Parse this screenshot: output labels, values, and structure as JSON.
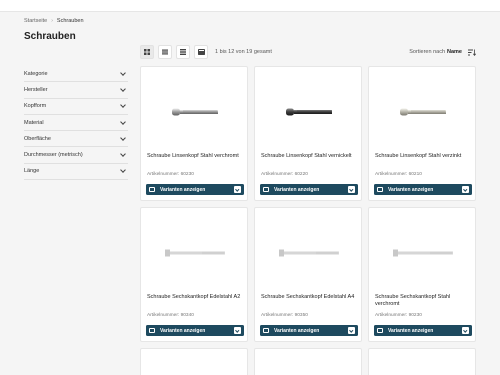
{
  "breadcrumb": {
    "home": "Startseite",
    "current": "Schrauben"
  },
  "page": {
    "title": "Schrauben"
  },
  "filters": [
    {
      "label": "Kategorie"
    },
    {
      "label": "Hersteller"
    },
    {
      "label": "Kopfform"
    },
    {
      "label": "Material"
    },
    {
      "label": "Oberfläche"
    },
    {
      "label": "Durchmesser (metrisch)"
    },
    {
      "label": "Länge"
    }
  ],
  "toolbar": {
    "views": [
      "grid-view-icon",
      "list-view-icon",
      "compact-view-icon",
      "table-view-icon"
    ],
    "active_view": 0,
    "result_count": "1 bis 12 von 19 gesamt",
    "sort_prefix": "Sortieren nach",
    "sort_value": "Name"
  },
  "colors": {
    "accent": "#1e4a5f",
    "background": "#f5f5f5"
  },
  "products": [
    {
      "name": "Schraube Linsenkopf Stahl verchromt",
      "article": "Artikelnummer: 60230",
      "button": "Varianten anzeigen",
      "image": "button-head-screw-chrome"
    },
    {
      "name": "Schraube Linsenkopf Stahl vernickelt",
      "article": "Artikelnummer: 60220",
      "button": "Varianten anzeigen",
      "image": "button-head-screw-dark"
    },
    {
      "name": "Schraube Linsenkopf Stahl verzinkt",
      "article": "Artikelnummer: 60210",
      "button": "Varianten anzeigen",
      "image": "button-head-screw-zinc"
    },
    {
      "name": "Schraube Sechskantkopf Edelstahl A2",
      "article": "Artikelnummer: 90340",
      "button": "Varianten anzeigen",
      "image": "hex-head-screw"
    },
    {
      "name": "Schraube Sechskantkopf Edelstahl A4",
      "article": "Artikelnummer: 90350",
      "button": "Varianten anzeigen",
      "image": "hex-head-screw"
    },
    {
      "name": "Schraube Sechskantkopf Stahl verchromt",
      "article": "Artikelnummer: 90230",
      "button": "Varianten anzeigen",
      "image": "hex-head-screw"
    }
  ]
}
